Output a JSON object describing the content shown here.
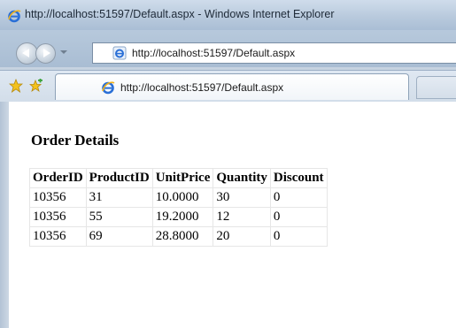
{
  "window": {
    "title": "http://localhost:51597/Default.aspx - Windows Internet Explorer"
  },
  "address_bar": {
    "url": "http://localhost:51597/Default.aspx"
  },
  "tab": {
    "label": "http://localhost:51597/Default.aspx"
  },
  "icons": {
    "ie": "ie-logo-icon",
    "back": "back-arrow-icon",
    "forward": "forward-arrow-icon",
    "favorites": "favorites-star-icon",
    "add_favorites": "add-to-favorites-icon"
  },
  "page": {
    "heading": "Order Details",
    "table": {
      "columns": [
        "OrderID",
        "ProductID",
        "UnitPrice",
        "Quantity",
        "Discount"
      ],
      "rows": [
        [
          "10356",
          "31",
          "10.0000",
          "30",
          "0"
        ],
        [
          "10356",
          "55",
          "19.2000",
          "12",
          "0"
        ],
        [
          "10356",
          "69",
          "28.8000",
          "20",
          "0"
        ]
      ]
    }
  },
  "colors": {
    "title_bar": "#b9cadd",
    "content_bg": "#ffffff",
    "ie_blue": "#2a6fd6",
    "ie_gold": "#f0b21c"
  }
}
